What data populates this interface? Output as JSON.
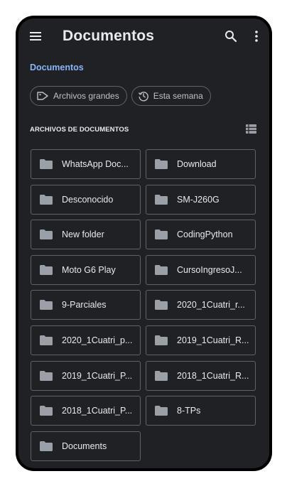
{
  "header": {
    "title": "Documentos",
    "menu_icon": "menu-icon",
    "search_icon": "search-icon",
    "more_icon": "more-vert-icon"
  },
  "breadcrumb": "Documentos",
  "chips": [
    {
      "label": "Archivos grandes",
      "icon": "label-icon"
    },
    {
      "label": "Esta semana",
      "icon": "history-icon"
    }
  ],
  "section": {
    "title": "ARCHIVOS DE DOCUMENTOS",
    "view_icon": "list-view-icon"
  },
  "folders": [
    "WhatsApp Doc...",
    "Download",
    "Desconocido",
    "SM-J260G",
    "New folder",
    "CodingPython",
    "Moto G6 Play",
    "CursoIngresoJ...",
    "9-Parciales",
    "2020_1Cuatri_r...",
    "2020_1Cuatri_p...",
    "2019_1Cuatri_R...",
    "2019_1Cuatri_P...",
    "2018_1Cuatri_R...",
    "2018_1Cuatri_P...",
    "8-TPs",
    "Documents"
  ],
  "colors": {
    "background": "#202124",
    "accent": "#8ab4f8",
    "text": "#e8eaed",
    "border": "#5f6368",
    "folder_icon": "#9aa0a6"
  }
}
